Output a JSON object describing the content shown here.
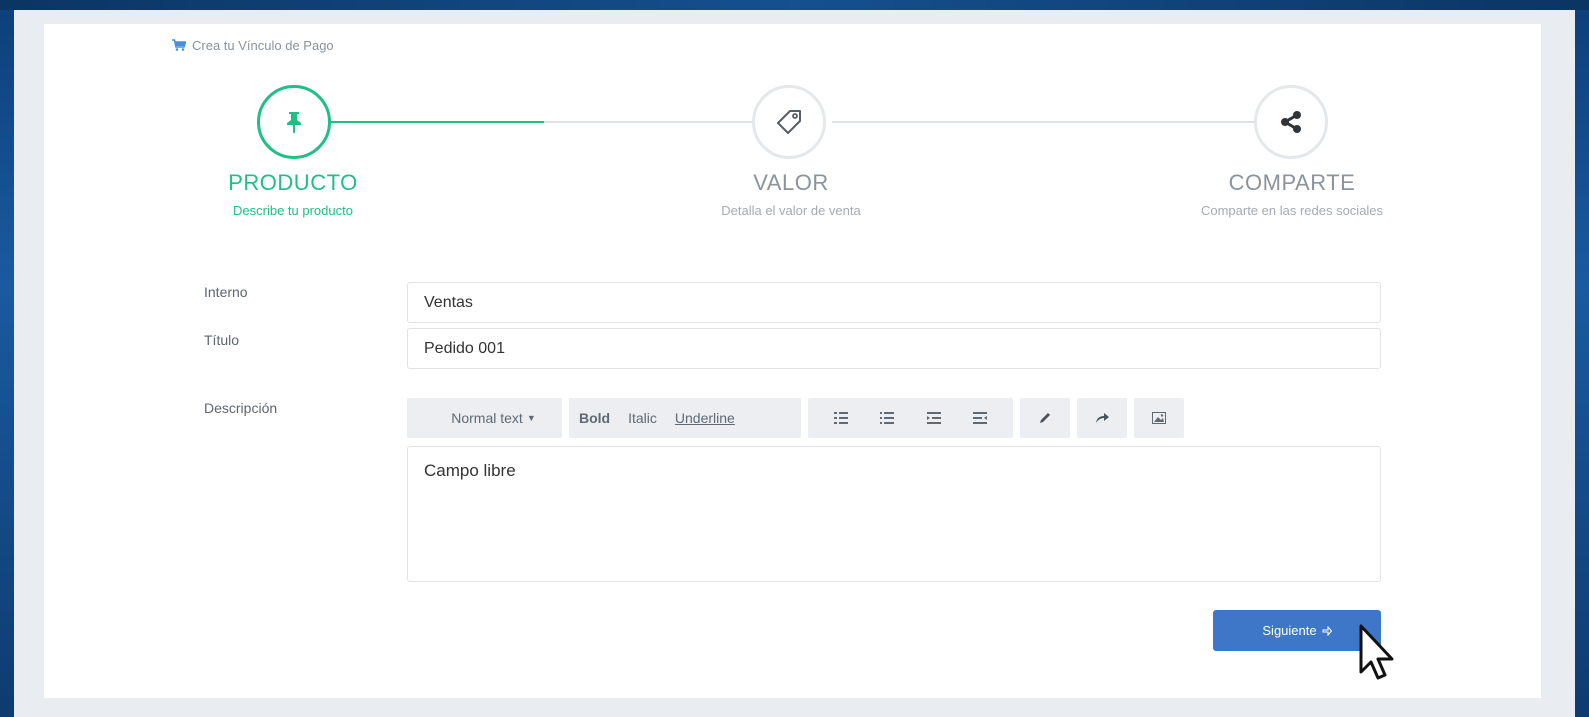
{
  "header": {
    "title": "Crea tu Vínculo de Pago",
    "icon": "cart-icon"
  },
  "wizard": {
    "active_color": "#1fbf86",
    "steps": [
      {
        "title": "PRODUCTO",
        "subtitle": "Describe tu producto",
        "icon": "pin-icon",
        "state": "active"
      },
      {
        "title": "VALOR",
        "subtitle": "Detalla el valor de venta",
        "icon": "tag-icon",
        "state": "pending"
      },
      {
        "title": "COMPARTE",
        "subtitle": "Comparte en las redes sociales",
        "icon": "share-icon",
        "state": "pending"
      }
    ]
  },
  "form": {
    "interno": {
      "label": "Interno",
      "value": "Ventas"
    },
    "titulo": {
      "label": "Título",
      "value": "Pedido 001"
    },
    "descripcion": {
      "label": "Descripción",
      "value": "Campo libre",
      "toolbar": {
        "format_select": "Normal text",
        "bold": "Bold",
        "italic": "Italic",
        "underline": "Underline",
        "list_icons": [
          "unordered-list-icon",
          "ordered-list-icon",
          "outdent-icon",
          "indent-icon"
        ],
        "pencil": "pencil-icon",
        "redo": "redo-icon",
        "image": "image-icon"
      }
    }
  },
  "actions": {
    "next_label": "Siguiente",
    "next_color": "#3f77c8"
  }
}
